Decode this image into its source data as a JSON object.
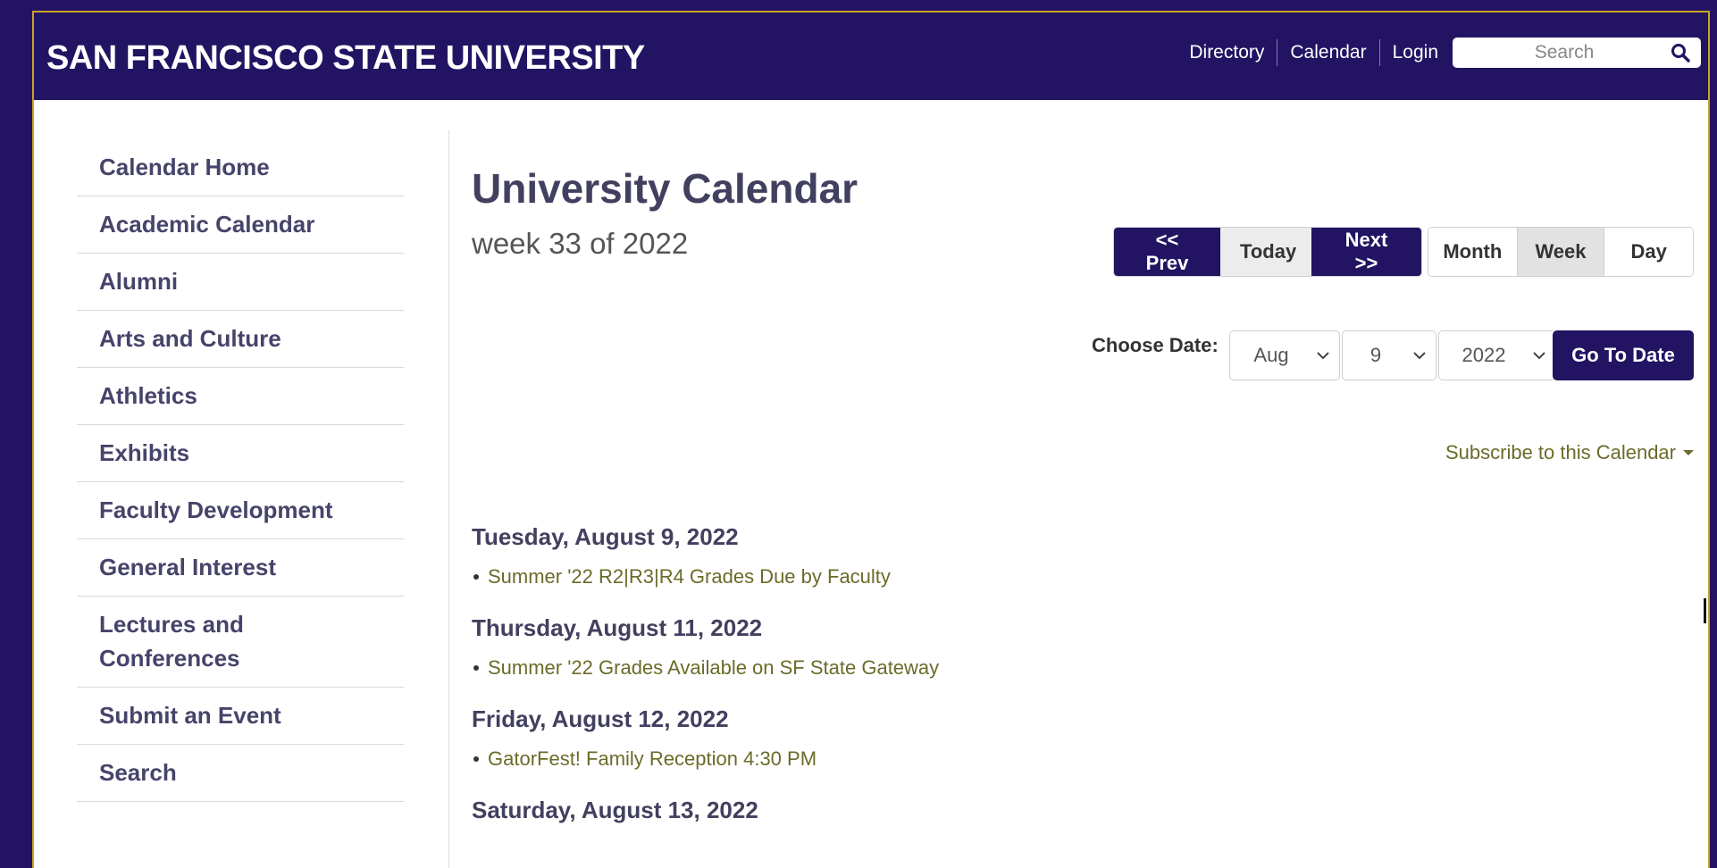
{
  "header": {
    "brand": "SAN FRANCISCO STATE UNIVERSITY",
    "nav": [
      {
        "label": "Directory"
      },
      {
        "label": "Calendar"
      },
      {
        "label": "Login"
      }
    ],
    "search_placeholder": "Search",
    "search_icon": "magnifier-icon"
  },
  "sidebar": {
    "items": [
      {
        "label": "Calendar Home"
      },
      {
        "label": "Academic Calendar"
      },
      {
        "label": "Alumni"
      },
      {
        "label": "Arts and Culture"
      },
      {
        "label": "Athletics"
      },
      {
        "label": "Exhibits"
      },
      {
        "label": "Faculty Development"
      },
      {
        "label": "General Interest"
      },
      {
        "label": "Lectures and Conferences"
      },
      {
        "label": "Submit an Event"
      },
      {
        "label": "Search"
      }
    ]
  },
  "main": {
    "title": "University Calendar",
    "week_label": "week 33 of 2022",
    "nav_buttons": {
      "prev": "<< Prev",
      "today": "Today",
      "next": "Next >>"
    },
    "view_buttons": {
      "month": "Month",
      "week": "Week",
      "day": "Day",
      "active": "Week"
    },
    "choose_date": {
      "label": "Choose Date:",
      "month": "Aug",
      "day": "9",
      "year": "2022",
      "button": "Go To Date"
    },
    "subscribe": "Subscribe to this Calendar",
    "days": [
      {
        "heading": "Tuesday, August 9, 2022",
        "events": [
          "Summer '22 R2|R3|R4 Grades Due by Faculty"
        ]
      },
      {
        "heading": "Thursday, August 11, 2022",
        "events": [
          "Summer '22 Grades Available on SF State Gateway"
        ]
      },
      {
        "heading": "Friday, August 12, 2022",
        "events": [
          "GatorFest! Family Reception 4:30 PM"
        ]
      },
      {
        "heading": "Saturday, August 13, 2022",
        "events": []
      }
    ]
  },
  "colors": {
    "brand_purple": "#231463",
    "gold_border": "#c9a227",
    "link_olive": "#6b6b2a",
    "heading_slate": "#42405f"
  }
}
